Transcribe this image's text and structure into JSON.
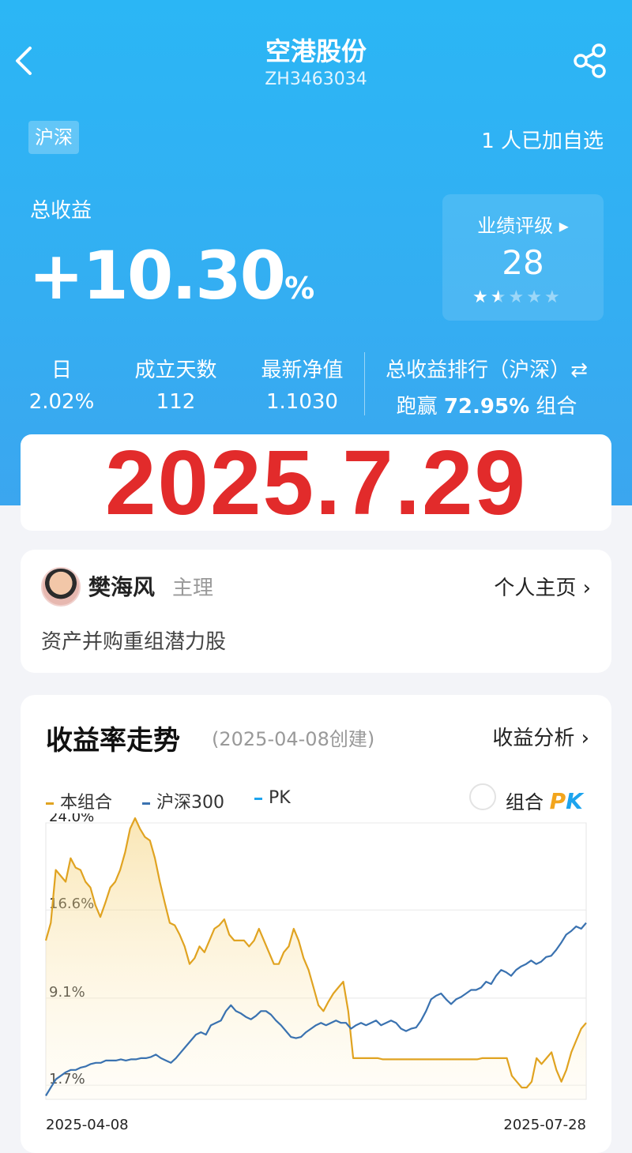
{
  "header": {
    "title": "空港股份",
    "code": "ZH3463034",
    "back_icon": "back-arrow-icon",
    "share_icon": "share-icon"
  },
  "summary": {
    "market_tag": "沪深",
    "followers": "1 人已加自选",
    "total_return_label": "总收益",
    "total_return_value": "+10.30",
    "total_return_unit": "%",
    "rating_label": "业绩评级 ▸",
    "rating_value": "28",
    "rating_stars": 1.5,
    "rating_stars_max": 5
  },
  "stats": [
    {
      "label": "日",
      "value": "2.02%"
    },
    {
      "label": "成立天数",
      "value": "112"
    },
    {
      "label": "最新净值",
      "value": "1.1030"
    }
  ],
  "rank": {
    "label": "总收益排行（沪深）⇄",
    "prefix": "跑赢 ",
    "value": "72.95%",
    "suffix": " 组合"
  },
  "date_banner": "2025.7.29",
  "manager": {
    "name": "樊海风",
    "role": "主理",
    "homepage_label": "个人主页 ›",
    "description": "资产并购重组潜力股"
  },
  "chart_card": {
    "title": "收益率走势",
    "created": "(2025-04-08创建)",
    "analysis_label": "收益分析 ›",
    "legend_combo": "本组合",
    "legend_index": "沪深300",
    "legend_pk": "PK",
    "pk_toggle_label": "组合",
    "pk_word_a": "P",
    "pk_word_b": "K",
    "combo_color": "#e0a321",
    "index_color": "#3a72b0",
    "pk_color": "#1da4ee"
  },
  "chart_data": {
    "type": "line",
    "x_start": "2025-04-08",
    "x_end": "2025-07-28",
    "y_ticks": [
      "24.0%",
      "16.6%",
      "9.1%",
      "1.7%"
    ],
    "y_tick_values": [
      24.0,
      16.6,
      9.1,
      1.7
    ],
    "ylim": [
      0.5,
      24.0
    ],
    "series": [
      {
        "name": "本组合",
        "values": [
          14.0,
          15.5,
          20.0,
          19.5,
          19.0,
          21.0,
          20.2,
          20.0,
          19.0,
          18.5,
          17.0,
          16.0,
          17.2,
          18.5,
          19.0,
          20.0,
          21.5,
          23.5,
          24.4,
          23.5,
          22.8,
          22.5,
          21.0,
          19.0,
          17.2,
          15.5,
          15.3,
          14.5,
          13.5,
          12.0,
          12.5,
          13.5,
          13.0,
          14.0,
          15.0,
          15.3,
          15.8,
          14.5,
          14.0,
          14.0,
          14.0,
          13.5,
          14.0,
          15.0,
          14.0,
          13.0,
          12.0,
          12.0,
          13.0,
          13.5,
          15.0,
          14.0,
          12.5,
          11.5,
          10.0,
          8.5,
          8.0,
          8.8,
          9.5,
          10.0,
          10.5,
          8.0,
          4.0,
          4.0,
          4.0,
          4.0,
          4.0,
          4.0,
          3.9,
          3.9,
          3.9,
          3.9,
          3.9,
          3.9,
          3.9,
          3.9,
          3.9,
          3.9,
          3.9,
          3.9,
          3.9,
          3.9,
          3.9,
          3.9,
          3.9,
          3.9,
          3.9,
          3.9,
          4.0,
          4.0,
          4.0,
          4.0,
          4.0,
          4.0,
          2.5,
          2.0,
          1.5,
          1.5,
          2.0,
          4.0,
          3.5,
          4.0,
          4.5,
          3.0,
          2.0,
          3.0,
          4.5,
          5.5,
          6.5,
          7.0
        ]
      },
      {
        "name": "沪深300",
        "values": [
          0.8,
          1.5,
          2.2,
          2.5,
          2.8,
          3.0,
          3.0,
          3.2,
          3.3,
          3.5,
          3.6,
          3.6,
          3.8,
          3.8,
          3.8,
          3.9,
          3.8,
          3.9,
          3.9,
          4.0,
          4.0,
          4.1,
          4.3,
          4.0,
          3.8,
          3.6,
          4.0,
          4.5,
          5.0,
          5.5,
          6.0,
          6.2,
          6.0,
          6.8,
          7.0,
          7.2,
          8.0,
          8.5,
          8.0,
          7.8,
          7.5,
          7.3,
          7.6,
          8.0,
          8.0,
          7.7,
          7.2,
          6.8,
          6.3,
          5.8,
          5.7,
          5.8,
          6.2,
          6.5,
          6.8,
          7.0,
          6.8,
          7.0,
          7.2,
          7.0,
          7.0,
          6.5,
          6.8,
          7.0,
          6.8,
          7.0,
          7.2,
          6.8,
          7.0,
          7.2,
          7.0,
          6.5,
          6.3,
          6.5,
          6.6,
          7.2,
          8.0,
          9.0,
          9.3,
          9.5,
          9.0,
          8.6,
          9.0,
          9.2,
          9.5,
          9.8,
          9.8,
          10.0,
          10.5,
          10.3,
          11.0,
          11.5,
          11.3,
          11.0,
          11.5,
          11.8,
          12.0,
          12.3,
          12.0,
          12.2,
          12.6,
          12.7,
          13.2,
          13.8,
          14.5,
          14.8,
          15.2,
          15.0,
          15.5
        ]
      }
    ],
    "grid": true
  }
}
